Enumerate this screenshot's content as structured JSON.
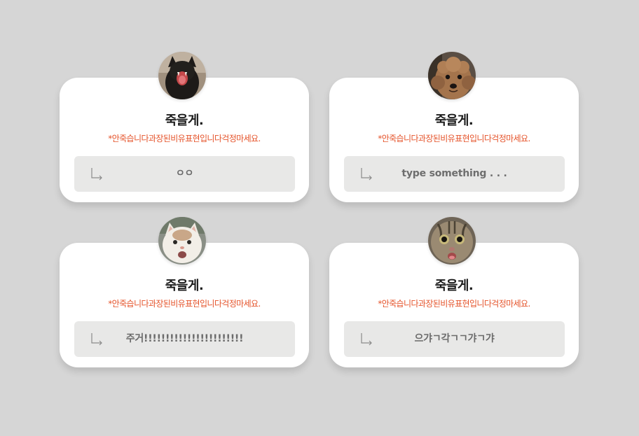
{
  "background_color": "#d6d6d6",
  "accent_color": "#e5532a",
  "cards": [
    {
      "avatar": "black-cat-yawning-photo",
      "title": "죽을게.",
      "notice": "*안죽습니다과장된비유표현입니다걱정마세요.",
      "reply_icon": "reply-arrow-icon",
      "reply_text": "ㅇㅇ",
      "reply_is_placeholder": false
    },
    {
      "avatar": "brown-poodle-photo",
      "title": "죽을게.",
      "notice": "*안죽습니다과장된비유표현입니다걱정마세요.",
      "reply_icon": "reply-arrow-icon",
      "reply_text": "type something . . .",
      "reply_is_placeholder": true
    },
    {
      "avatar": "white-cat-face-photo",
      "title": "죽을게.",
      "notice": "*안죽습니다과장된비유표현입니다걱정마세요.",
      "reply_icon": "reply-arrow-icon",
      "reply_text": "주거!!!!!!!!!!!!!!!!!!!!!!!",
      "reply_is_placeholder": false
    },
    {
      "avatar": "tabby-cat-face-photo",
      "title": "죽을게.",
      "notice": "*안죽습니다과장된비유표현입니다걱정마세요.",
      "reply_icon": "reply-arrow-icon",
      "reply_text": "으갸ㄱ각ㄱㄱ갸ㄱ갸",
      "reply_is_placeholder": false
    }
  ]
}
